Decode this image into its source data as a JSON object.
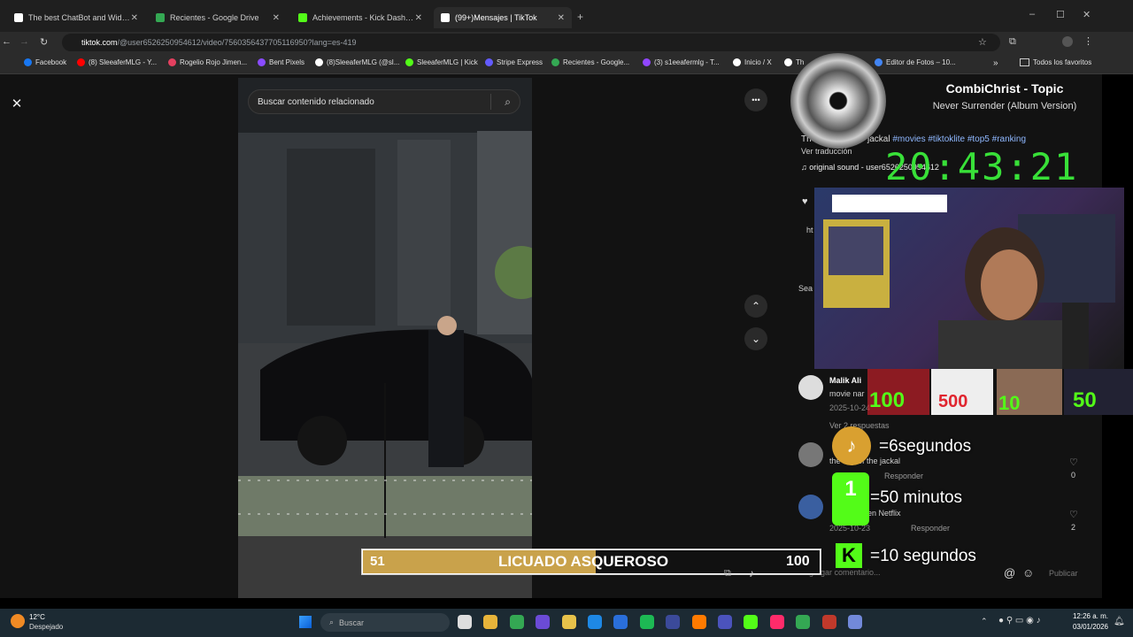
{
  "browser": {
    "tabs": [
      {
        "label": "The best ChatBot and Widgets",
        "color": "#ffffff",
        "active": false
      },
      {
        "label": "Recientes - Google Drive",
        "color": "#34a853",
        "active": false
      },
      {
        "label": "Achievements - Kick Dashboard",
        "color": "#53fc18",
        "active": false
      },
      {
        "label": "(99+)Mensajes | TikTok",
        "color": "#ffffff",
        "active": true
      }
    ],
    "new_tab": "+",
    "url_host": "tiktok.com",
    "url_path": "/@user6526250954612/video/7560356437705116950?lang=es-419",
    "bookmarks": [
      {
        "label": "Facebook",
        "color": "#1877f2"
      },
      {
        "label": "(8) SleeaferMLG - Y...",
        "color": "#ff0000"
      },
      {
        "label": "Rogelio Rojo Jimen...",
        "color": "#e4405f"
      },
      {
        "label": "Bent Pixels",
        "color": "#8a4bff"
      },
      {
        "label": "(8)SleeaferMLG (@sl...",
        "color": "#ffffff"
      },
      {
        "label": "SleeaferMLG | Kick",
        "color": "#53fc18"
      },
      {
        "label": "Stripe Express",
        "color": "#635bff"
      },
      {
        "label": "Recientes - Google...",
        "color": "#34a853"
      },
      {
        "label": "(3) s1eeafermlg - T...",
        "color": "#9146ff"
      },
      {
        "label": "Inicio / X",
        "color": "#ffffff"
      },
      {
        "label": "Th",
        "color": "#ffffff"
      },
      {
        "label": "Editor de Fotos – 10...",
        "color": "#4285f4"
      }
    ],
    "bookmarks_more": "»",
    "all_bookmarks": "Todos los favoritos"
  },
  "tiktok": {
    "search_placeholder": "Buscar contenido relacionado",
    "close": "✕",
    "more": "•••",
    "nav_up": "⌃",
    "nav_down": "⌄",
    "caption_partial": "jackal",
    "hashtags": "#movies #tiktoklite #top5 #ranking",
    "caption_prefix": "Th",
    "see_translation": "Ver traducción",
    "sound": "original sound - user6526250954612",
    "search_prefix": "Sea",
    "side_label": "ht",
    "comments": [
      {
        "user": "Malik Ali",
        "text": "movie nar",
        "date": "2025-10-24"
      },
      {
        "replies": "Ver 2 respuestas"
      },
      {
        "text": "the day of the jackal",
        "reply": "Responder",
        "likes": "0"
      },
      {
        "text": "en Netflix",
        "date": "2025-10-23",
        "reply": "Responder",
        "likes": "2"
      }
    ],
    "comment_placeholder": "Agregar comentario...",
    "publish": "Publicar"
  },
  "overlay": {
    "artist": "CombiChrist - Topic",
    "song": "Never Surrender (Album Version)",
    "clock": "20:43:21",
    "badge_100": "100",
    "badge_500": "500",
    "badge_10": "10",
    "badge_50": "50",
    "rule_tiktok": "=6segundos",
    "rule_sub": "=50 minutos",
    "rule_kick": "=10 segundos",
    "goal_current": "51",
    "goal_title": "LICUADO ASQUEROSO",
    "goal_target": "100",
    "goal_progress": 0.51
  },
  "taskbar": {
    "temp": "12°C",
    "weather": "Despejado",
    "search": "Buscar",
    "time": "12:26 a. m.",
    "date": "03/01/2026"
  }
}
